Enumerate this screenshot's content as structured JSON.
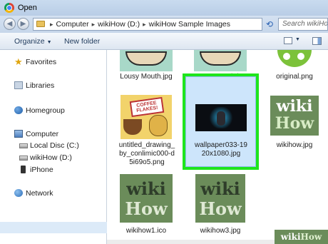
{
  "window": {
    "title": "Open",
    "app_icon": "chrome-icon"
  },
  "address": {
    "breadcrumbs": [
      "Computer",
      "wikiHow (D:)",
      "wikiHow Sample Images"
    ],
    "separator": "▸",
    "search_placeholder": "Search wikiHow"
  },
  "toolbar": {
    "organize_label": "Organize",
    "new_folder_label": "New folder"
  },
  "navigation": {
    "items": [
      {
        "label": "Favorites",
        "icon": "star-icon"
      },
      {
        "label": "Libraries",
        "icon": "library-icon"
      },
      {
        "label": "Homegroup",
        "icon": "homegroup-icon"
      },
      {
        "label": "Computer",
        "icon": "computer-icon"
      },
      {
        "label": "Local Disc (C:)",
        "icon": "disk-icon"
      },
      {
        "label": "wikiHow (D:)",
        "icon": "disk-icon",
        "selected": true
      },
      {
        "label": "iPhone",
        "icon": "phone-icon"
      },
      {
        "label": "Network",
        "icon": "network-icon"
      }
    ]
  },
  "files": [
    {
      "name": "Lousy Mouth.jpg"
    },
    {
      "name": "Lousy Mouth.jpg"
    },
    {
      "name": "original.png"
    },
    {
      "name": "untitled_drawing_by_conlimic000-d5i69o5.png",
      "lines": [
        "untitled_drawing_",
        "by_conlimic000-d",
        "5i69o5.png"
      ],
      "art_text": "COFFEE FLAKES!"
    },
    {
      "name": "wallpaper033-1920x1080.jpg",
      "lines": [
        "wallpaper033-19",
        "20x1080.jpg"
      ],
      "highlighted": true
    },
    {
      "name": "wikihow.jpg",
      "art_text": [
        "wiki",
        "How"
      ]
    },
    {
      "name": "wikihow1.ico",
      "art_text": [
        "wiki",
        "How"
      ]
    },
    {
      "name": "wikihow3.jpg",
      "art_text": [
        "wiki",
        "How"
      ]
    }
  ],
  "watermark": {
    "wiki": "wiki",
    "how": "How"
  },
  "colors": {
    "highlight": "#1fe51c",
    "wikihow_green": "#6b8c5a"
  }
}
